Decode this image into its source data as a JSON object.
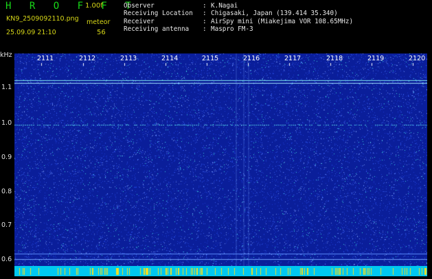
{
  "header": {
    "title": "H R O F F T",
    "version": "1.00f",
    "filename": "KN9_2509092110.png",
    "meteor_label": "meteor",
    "datetime": "25.09.09 21:10",
    "meteor_count": "56"
  },
  "info": [
    {
      "key": "Observer",
      "sep": ":",
      "value": "K.Nagai"
    },
    {
      "key": "Receiving Location",
      "sep": ":",
      "value": "Chigasaki, Japan (139.414 35.340)"
    },
    {
      "key": "Receiver",
      "sep": ":",
      "value": "AirSpy mini (Miakejima VOR 108.65MHz)"
    },
    {
      "key": "Receiving antenna",
      "sep": ":",
      "value": "Maspro FM-3"
    }
  ],
  "spectrogram": {
    "freq_unit": "kHz",
    "freq_ticks": [
      "1.1",
      "1.0",
      "0.9",
      "0.8",
      "0.7",
      "0.6"
    ],
    "time_ticks": [
      "2111",
      "2112",
      "2113",
      "2114",
      "2115",
      "2116",
      "2117",
      "2118",
      "2119",
      "2120"
    ],
    "colors": {
      "background": "#0a1e9a",
      "noise_cyan": "#3ad0e0",
      "noise_light": "#6a8cf0",
      "bar_cyan": "#00c8f0",
      "tick_yellow": "#f0e020"
    }
  }
}
